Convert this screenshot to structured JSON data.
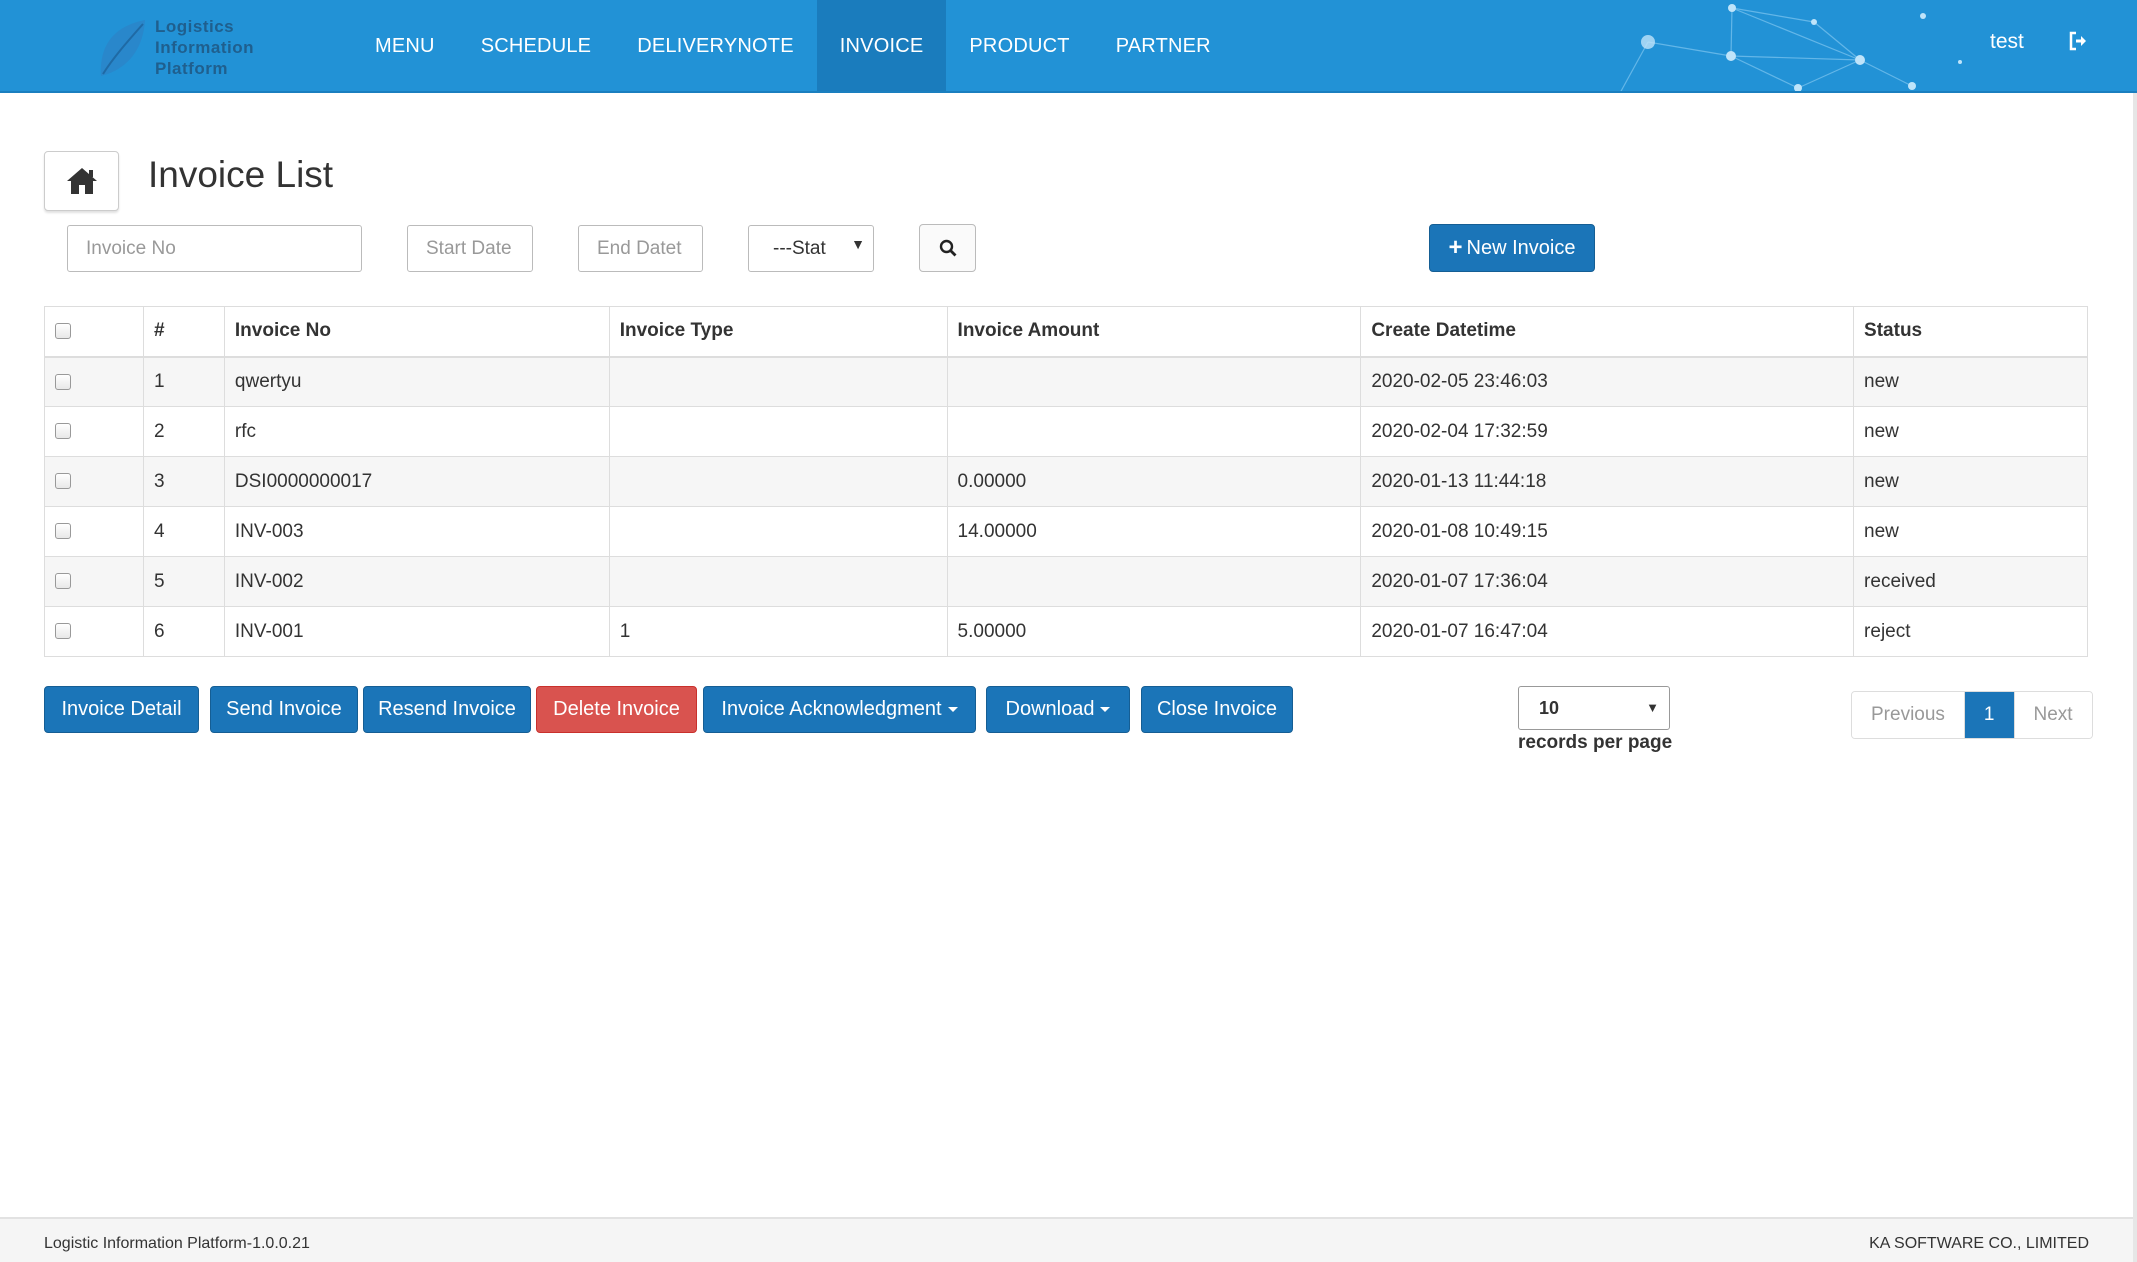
{
  "brand": {
    "logo_lines": [
      "Logistics",
      "Information",
      "Platform"
    ]
  },
  "nav": {
    "items": [
      "MENU",
      "SCHEDULE",
      "DELIVERYNOTE",
      "INVOICE",
      "PRODUCT",
      "PARTNER"
    ],
    "active": "INVOICE",
    "user": "test",
    "logout_icon": "sign-out-icon"
  },
  "page": {
    "title": "Invoice List",
    "home_icon": "home-icon"
  },
  "filters": {
    "invoice_no_placeholder": "Invoice No",
    "start_date_placeholder": "Start Date",
    "end_date_placeholder": "End Datet",
    "status_selected": "---Stat",
    "search_icon": "search-icon",
    "new_invoice_label": "New Invoice"
  },
  "table": {
    "headers": [
      "#",
      "Invoice No",
      "Invoice Type",
      "Invoice Amount",
      "Create Datetime",
      "Status"
    ],
    "rows": [
      [
        "1",
        "qwertyu",
        "",
        "",
        "2020-02-05 23:46:03",
        "new"
      ],
      [
        "2",
        "rfc",
        "",
        "",
        "2020-02-04 17:32:59",
        "new"
      ],
      [
        "3",
        "DSI0000000017",
        "",
        "0.00000",
        "2020-01-13 11:44:18",
        "new"
      ],
      [
        "4",
        "INV-003",
        "",
        "14.00000",
        "2020-01-08 10:49:15",
        "new"
      ],
      [
        "5",
        "INV-002",
        "",
        "",
        "2020-01-07 17:36:04",
        "received"
      ],
      [
        "6",
        "INV-001",
        "1",
        "5.00000",
        "2020-01-07 16:47:04",
        "reject"
      ]
    ]
  },
  "actions": {
    "invoice_detail": "Invoice Detail",
    "send_invoice": "Send Invoice",
    "resend_invoice": "Resend Invoice",
    "delete_invoice": "Delete Invoice",
    "invoice_ack": "Invoice Acknowledgment",
    "download": "Download",
    "close_invoice": "Close Invoice"
  },
  "paging": {
    "per_page": "10",
    "per_page_label": "records per page",
    "previous": "Previous",
    "current": "1",
    "next": "Next"
  },
  "footer": {
    "left": "Logistic Information Platform-1.0.0.21",
    "right": "KA SOFTWARE CO., LIMITED"
  },
  "colors": {
    "navbar": "#2292d6",
    "primary": "#1b75b8",
    "danger": "#d9534f"
  }
}
